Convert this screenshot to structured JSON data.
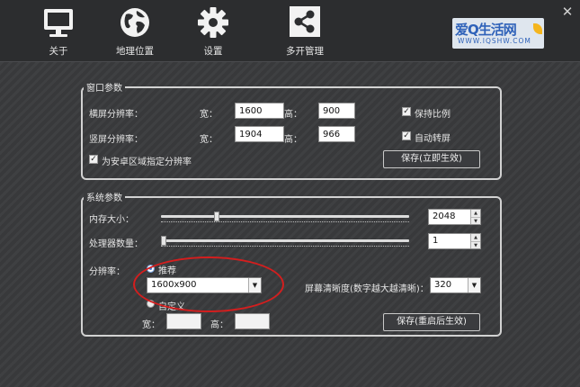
{
  "toolbar": {
    "items": [
      {
        "label": "关于",
        "icon": "monitor-icon"
      },
      {
        "label": "地理位置",
        "icon": "globe-icon"
      },
      {
        "label": "设置",
        "icon": "gear-icon"
      },
      {
        "label": "多开管理",
        "icon": "share-icon"
      }
    ]
  },
  "logo": {
    "brand": "爱Q生活网",
    "url": "WWW.IQSHW.COM"
  },
  "window_params": {
    "title": "窗口参数",
    "landscape_label": "横屏分辨率：",
    "portrait_label": "竖屏分辨率：",
    "width_label": "宽：",
    "height_label": "高：",
    "landscape_width": "1600",
    "landscape_height": "900",
    "portrait_width": "1904",
    "portrait_height": "966",
    "keep_ratio_label": "保持比例",
    "keep_ratio_checked": true,
    "auto_rotate_label": "自动转屏",
    "auto_rotate_checked": true,
    "desktop_area_label": "为安卓区域指定分辨率",
    "desktop_area_checked": true,
    "save_label": "保存(立即生效)"
  },
  "system_params": {
    "title": "系统参数",
    "memory_label": "内存大小：",
    "memory_value": "2048",
    "memory_slider_fraction": 0.22,
    "cpu_label": "处理器数量：",
    "cpu_value": "1",
    "cpu_slider_fraction": 0.0,
    "resolution_label": "分辨率：",
    "recommended_label": "推荐",
    "recommended_selected": true,
    "resolution_select_value": "1600x900",
    "custom_label": "自定义",
    "custom_width_label": "宽：",
    "custom_height_label": "高：",
    "custom_width_value": "",
    "custom_height_value": "",
    "clarity_label": "屏幕清晰度(数字越大越清晰)：",
    "clarity_value": "320",
    "save_label": "保存(重启后生效)"
  },
  "colors": {
    "background": "#3a3b3d",
    "toolbar": "#2c2d2f",
    "annotation_ellipse": "#d41e1e",
    "radio_selected": "#3f7ed8",
    "logo_text": "#2f62b9"
  }
}
